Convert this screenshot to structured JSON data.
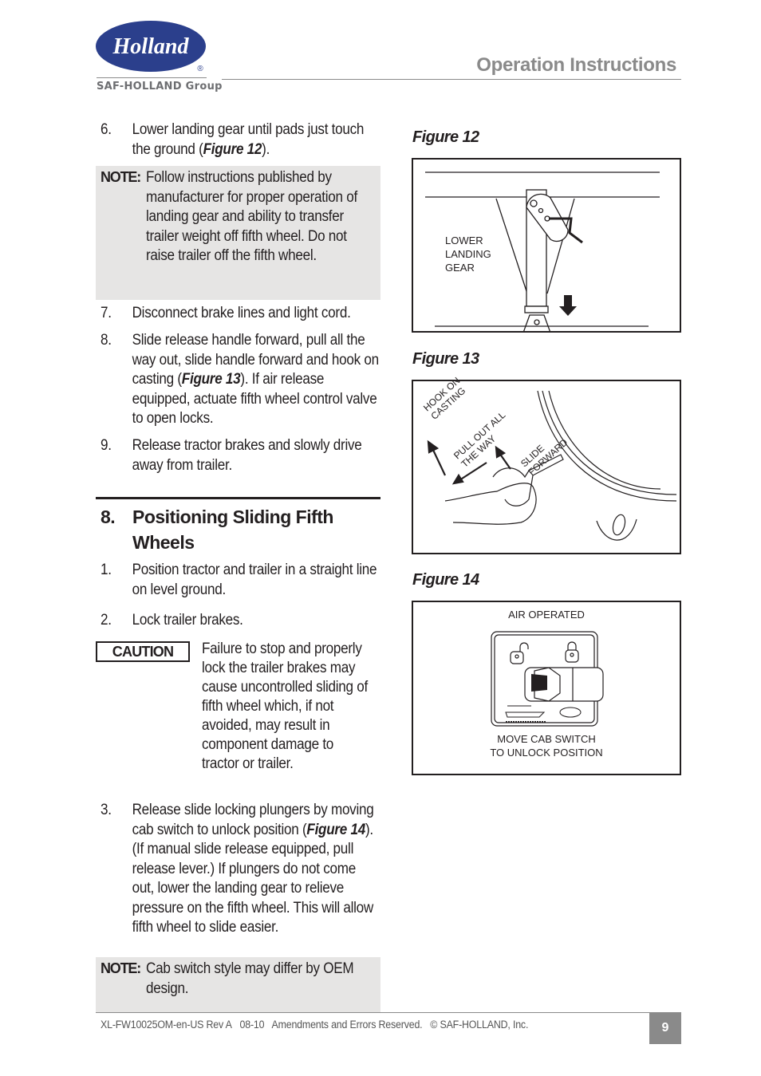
{
  "header": {
    "logo_text": "Holland",
    "logo_registered": "®",
    "logo_group": "SAF-HOLLAND Group",
    "title": "Operation Instructions",
    "brand_color": "#2b3f8c",
    "title_color": "#8a8a8a"
  },
  "left_column": {
    "step6": {
      "num": "6.",
      "text_before": "Lower landing gear until pads just touch the ground (",
      "fig_ref": "Figure 12",
      "text_after": ")."
    },
    "note1": {
      "label": "NOTE:",
      "text": "Follow instructions published by manufacturer for proper operation of landing gear and ability to transfer trailer weight off fifth wheel. Do not raise trailer off the fifth wheel."
    },
    "step7": {
      "num": "7.",
      "text": "Disconnect brake lines and light cord."
    },
    "step8": {
      "num": "8.",
      "text_before": "Slide release handle forward, pull all the way out, slide handle forward and hook on casting (",
      "fig_ref": "Figure 13",
      "text_after": ").  If air release equipped, actuate fifth wheel control valve to open locks."
    },
    "step9": {
      "num": "9.",
      "text": "Release tractor brakes and slowly drive away from trailer."
    },
    "section": {
      "num": "8.",
      "title": "Positioning Sliding Fifth Wheels"
    },
    "s_step1": {
      "num": "1.",
      "text": "Position tractor and trailer in a straight line on level ground."
    },
    "s_step2": {
      "num": "2.",
      "text": "Lock trailer brakes."
    },
    "caution": {
      "label": "CAUTION",
      "text": "Failure to stop and properly lock the trailer brakes may cause uncontrolled sliding of fifth wheel which, if not avoided, may result in component damage to tractor or trailer."
    },
    "s_step3": {
      "num": "3.",
      "text_before": "Release slide locking plungers by moving cab switch to unlock position (",
      "fig_ref": "Figure 14",
      "text_after": "). (If manual slide release equipped, pull release lever.) If plungers do not come out, lower the landing gear to relieve pressure on the fifth wheel. This will allow fifth wheel to slide easier."
    },
    "note2": {
      "label": "NOTE:",
      "text": "Cab switch style may differ by OEM design."
    }
  },
  "figures": {
    "fig12": {
      "title": "Figure 12",
      "label": [
        "LOWER",
        "LANDING",
        "GEAR"
      ],
      "icon": "down-arrow-icon"
    },
    "fig13": {
      "title": "Figure 13",
      "labels": {
        "hook": [
          "HOOK ON",
          "CASTING"
        ],
        "pull": [
          "PULL OUT ALL",
          "THE WAY"
        ],
        "slide": [
          "SLIDE",
          "FORWARD"
        ]
      }
    },
    "fig14": {
      "title": "Figure 14",
      "top_label": "AIR OPERATED",
      "bottom_label": [
        "MOVE CAB SWITCH",
        "TO UNLOCK POSITION"
      ],
      "icons": [
        "unlocked-padlock-icon",
        "locked-padlock-icon",
        "slider-icon",
        "holland-badge-icon"
      ]
    }
  },
  "footer": {
    "doc_id": "XL-FW10025OM-en-US Rev A",
    "date": "08-10",
    "notice": "Amendments and Errors Reserved.",
    "copyright": "© SAF-HOLLAND, Inc.",
    "page_number": "9"
  }
}
